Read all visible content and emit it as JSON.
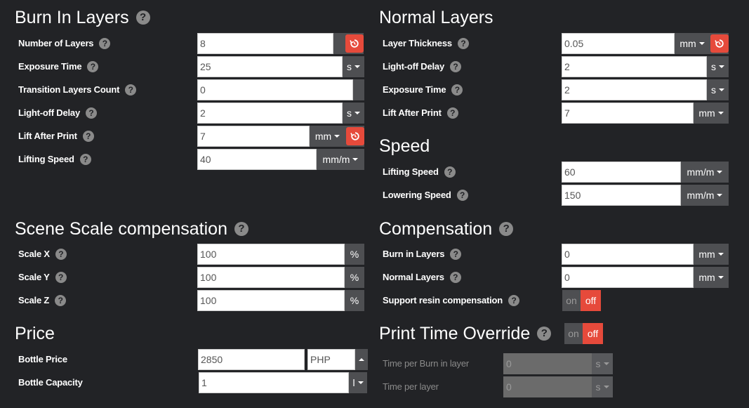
{
  "burn": {
    "title": "Burn In Layers",
    "num_layers": {
      "label": "Number of Layers",
      "value": "8"
    },
    "exposure": {
      "label": "Exposure Time",
      "value": "25",
      "unit": "s"
    },
    "transition": {
      "label": "Transition Layers Count",
      "value": "0"
    },
    "lightoff": {
      "label": "Light-off Delay",
      "value": "2",
      "unit": "s"
    },
    "lift": {
      "label": "Lift After Print",
      "value": "7",
      "unit": "mm"
    },
    "lifting_speed": {
      "label": "Lifting Speed",
      "value": "40",
      "unit": "mm/m"
    }
  },
  "normal": {
    "title": "Normal Layers",
    "thickness": {
      "label": "Layer Thickness",
      "value": "0.05",
      "unit": "mm"
    },
    "lightoff": {
      "label": "Light-off Delay",
      "value": "2",
      "unit": "s"
    },
    "exposure": {
      "label": "Exposure Time",
      "value": "2",
      "unit": "s"
    },
    "lift": {
      "label": "Lift After Print",
      "value": "7",
      "unit": "mm"
    }
  },
  "speed": {
    "title": "Speed",
    "lifting": {
      "label": "Lifting Speed",
      "value": "60",
      "unit": "mm/m"
    },
    "lowering": {
      "label": "Lowering Speed",
      "value": "150",
      "unit": "mm/m"
    }
  },
  "scale": {
    "title": "Scene Scale compensation",
    "x": {
      "label": "Scale X",
      "value": "100",
      "unit": "%"
    },
    "y": {
      "label": "Scale Y",
      "value": "100",
      "unit": "%"
    },
    "z": {
      "label": "Scale Z",
      "value": "100",
      "unit": "%"
    }
  },
  "comp": {
    "title": "Compensation",
    "burn": {
      "label": "Burn in Layers",
      "value": "0",
      "unit": "mm"
    },
    "normal": {
      "label": "Normal Layers",
      "value": "0",
      "unit": "mm"
    },
    "resin": {
      "label": "Support resin compensation",
      "on": "on",
      "off": "off"
    }
  },
  "price": {
    "title": "Price",
    "bottle_price": {
      "label": "Bottle Price",
      "value": "2850",
      "currency": "PHP"
    },
    "bottle_capacity": {
      "label": "Bottle Capacity",
      "value": "1",
      "unit": "l"
    }
  },
  "override": {
    "title": "Print Time Override",
    "on": "on",
    "off": "off",
    "burn_layer": {
      "label": "Time per Burn in layer",
      "value": "0",
      "unit": "s"
    },
    "layer": {
      "label": "Time per layer",
      "value": "0",
      "unit": "s"
    }
  },
  "help_glyph": "?",
  "colors": {
    "background": "#222326",
    "accent": "#e64a3b",
    "addon": "#4e4f52"
  }
}
